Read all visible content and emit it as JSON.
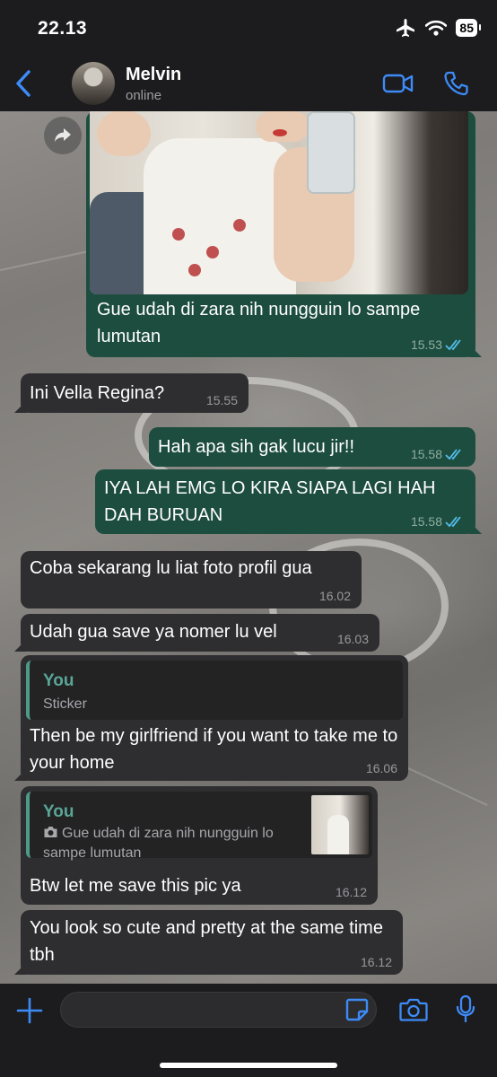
{
  "status_bar": {
    "time": "22.13",
    "battery": "85"
  },
  "header": {
    "back_icon": "chevron-left-icon",
    "contact_name": "Melvin",
    "contact_status": "online",
    "video_icon": "video-camera-icon",
    "call_icon": "phone-icon"
  },
  "colors": {
    "accent": "#3d8bf7",
    "outgoing_bubble": "#1d4d3e",
    "incoming_bubble": "#2e2e30",
    "quote_author": "#5aa597",
    "read_tick": "#53bdeb"
  },
  "messages": [
    {
      "direction": "out",
      "type": "image",
      "caption": "Gue udah di zara nih nungguin lo sampe lumutan",
      "time": "15.53",
      "read": true
    },
    {
      "direction": "in",
      "text": "Ini Vella Regina?",
      "time": "15.55"
    },
    {
      "direction": "out",
      "text": "Hah apa sih gak lucu jir!!",
      "time": "15.58",
      "read": true
    },
    {
      "direction": "out",
      "text": "IYA LAH EMG LO KIRA SIAPA LAGI HAH DAH BURUAN",
      "time": "15.58",
      "read": true
    },
    {
      "direction": "in",
      "text": "Coba sekarang lu liat foto profil gua",
      "time": "16.02"
    },
    {
      "direction": "in",
      "text": "Udah gua save ya nomer lu vel",
      "time": "16.03"
    },
    {
      "direction": "in",
      "quote": {
        "author": "You",
        "text": "Sticker"
      },
      "text": "Then be my girlfriend if you want to take me to your home",
      "time": "16.06"
    },
    {
      "direction": "in",
      "quote": {
        "author": "You",
        "icon": "camera-icon",
        "text": "Gue udah di zara nih nungguin lo sampe lumutan"
      },
      "text": "Btw let me save this pic ya",
      "time": "16.12"
    },
    {
      "direction": "in",
      "text": "You look so cute and pretty at the same time tbh",
      "time": "16.12"
    }
  ],
  "input": {
    "placeholder": ""
  }
}
